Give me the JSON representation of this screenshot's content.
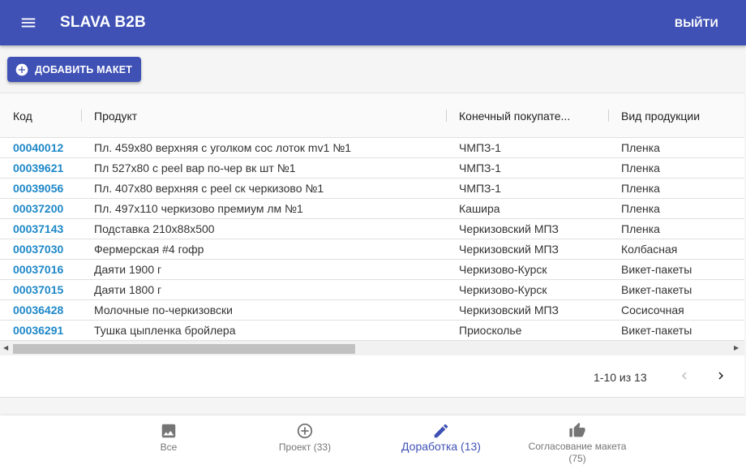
{
  "header": {
    "title": "SLAVA B2B",
    "logout_label": "ВЫЙТИ"
  },
  "toolbar": {
    "add_label": "ДОБАВИТЬ МАКЕТ"
  },
  "table": {
    "columns": [
      "Код",
      "Продукт",
      "Конечный покупате...",
      "Вид продукции"
    ],
    "rows": [
      [
        "00040012",
        "Пл. 459х80 верхняя с уголком сос лоток mv1 №1",
        "ЧМПЗ-1",
        "Пленка"
      ],
      [
        "00039621",
        "Пл 527х80 с peel вар по-чер вк шт №1",
        "ЧМПЗ-1",
        "Пленка"
      ],
      [
        "00039056",
        "Пл. 407х80 верхняя с peel ск черкизово №1",
        "ЧМПЗ-1",
        "Пленка"
      ],
      [
        "00037200",
        "Пл. 497х110 черкизово премиум лм №1",
        "Кашира",
        "Пленка"
      ],
      [
        "00037143",
        "Подставка 210х88х500",
        "Черкизовский МПЗ",
        "Пленка"
      ],
      [
        "00037030",
        "Фермерская #4 гофр",
        "Черкизовский МПЗ",
        "Колбасная"
      ],
      [
        "00037016",
        "Даяти 1900 г",
        "Черкизово-Курск",
        "Викет-пакеты"
      ],
      [
        "00037015",
        "Даяти 1800 г",
        "Черкизово-Курск",
        "Викет-пакеты"
      ],
      [
        "00036428",
        "Молочные по-черкизовски",
        "Черкизовский МПЗ",
        "Сосисочная"
      ],
      [
        "00036291",
        "Тушка цыпленка бройлера",
        "Приосколье",
        "Викет-пакеты"
      ]
    ]
  },
  "pagination": {
    "range_text": "1-10 из 13"
  },
  "bottom_nav": {
    "items": [
      {
        "label": "Все",
        "icon": "image-icon"
      },
      {
        "label": "Проект (33)",
        "icon": "add-circle-icon"
      },
      {
        "label": "Доработка (13)",
        "icon": "pencil-icon"
      },
      {
        "label": "Согласование макета (75)",
        "icon": "thumb-up-icon"
      }
    ]
  },
  "colors": {
    "primary": "#3f51b5",
    "link": "#1e88c8"
  }
}
